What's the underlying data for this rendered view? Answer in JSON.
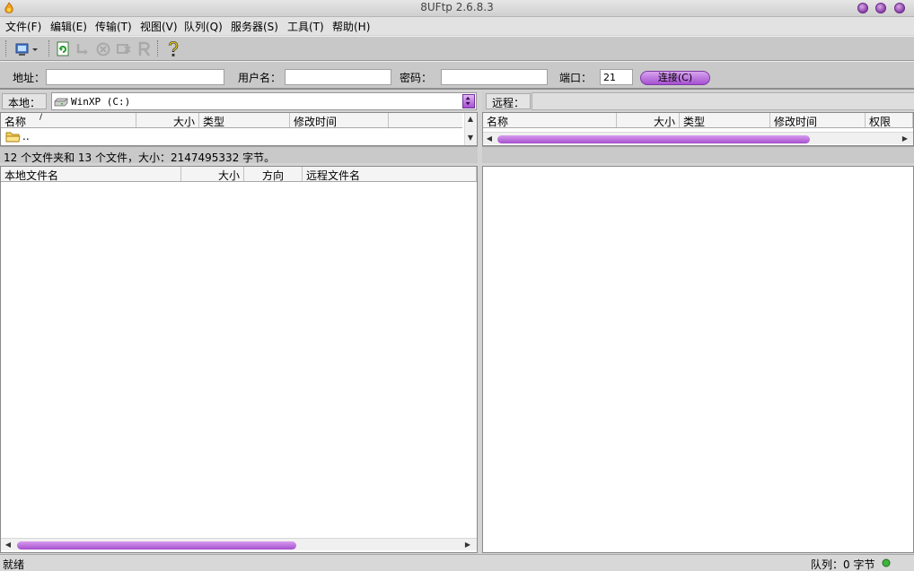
{
  "window": {
    "title": "8UFtp 2.6.8.3"
  },
  "menu": [
    {
      "label": "文件(F)"
    },
    {
      "label": "编辑(E)"
    },
    {
      "label": "传输(T)"
    },
    {
      "label": "视图(V)"
    },
    {
      "label": "队列(Q)"
    },
    {
      "label": "服务器(S)"
    },
    {
      "label": "工具(T)"
    },
    {
      "label": "帮助(H)"
    }
  ],
  "toolbar": {
    "icons": [
      "site-manager-icon",
      "refresh-icon",
      "process-queue-icon",
      "cancel-icon",
      "disconnect-icon",
      "reconnect-icon",
      "help-icon"
    ]
  },
  "connection": {
    "address_label": "地址：",
    "address_value": "",
    "username_label": "用户名：",
    "username_value": "",
    "password_label": "密码：",
    "password_value": "",
    "port_label": "端口：",
    "port_value": "21",
    "connect_label": "连接(C)"
  },
  "local": {
    "label": "本地：",
    "drive": "WinXP (C:)",
    "columns": [
      "名称",
      "大小",
      "类型",
      "修改时间"
    ],
    "sort_indicator": "/",
    "rows": [
      {
        "name": ".."
      }
    ],
    "status": "12 个文件夹和 13 个文件，大小：2147495332 字节。"
  },
  "remote": {
    "label": "远程：",
    "columns": [
      "名称",
      "大小",
      "类型",
      "修改时间",
      "权限"
    ]
  },
  "queue": {
    "columns": [
      "本地文件名",
      "大小",
      "方向",
      "远程文件名"
    ]
  },
  "statusbar": {
    "left": "就绪",
    "queue_text": "队列：0 字节"
  },
  "colors": {
    "accent": "#a651d1",
    "accent_light": "#d7a3ef"
  }
}
